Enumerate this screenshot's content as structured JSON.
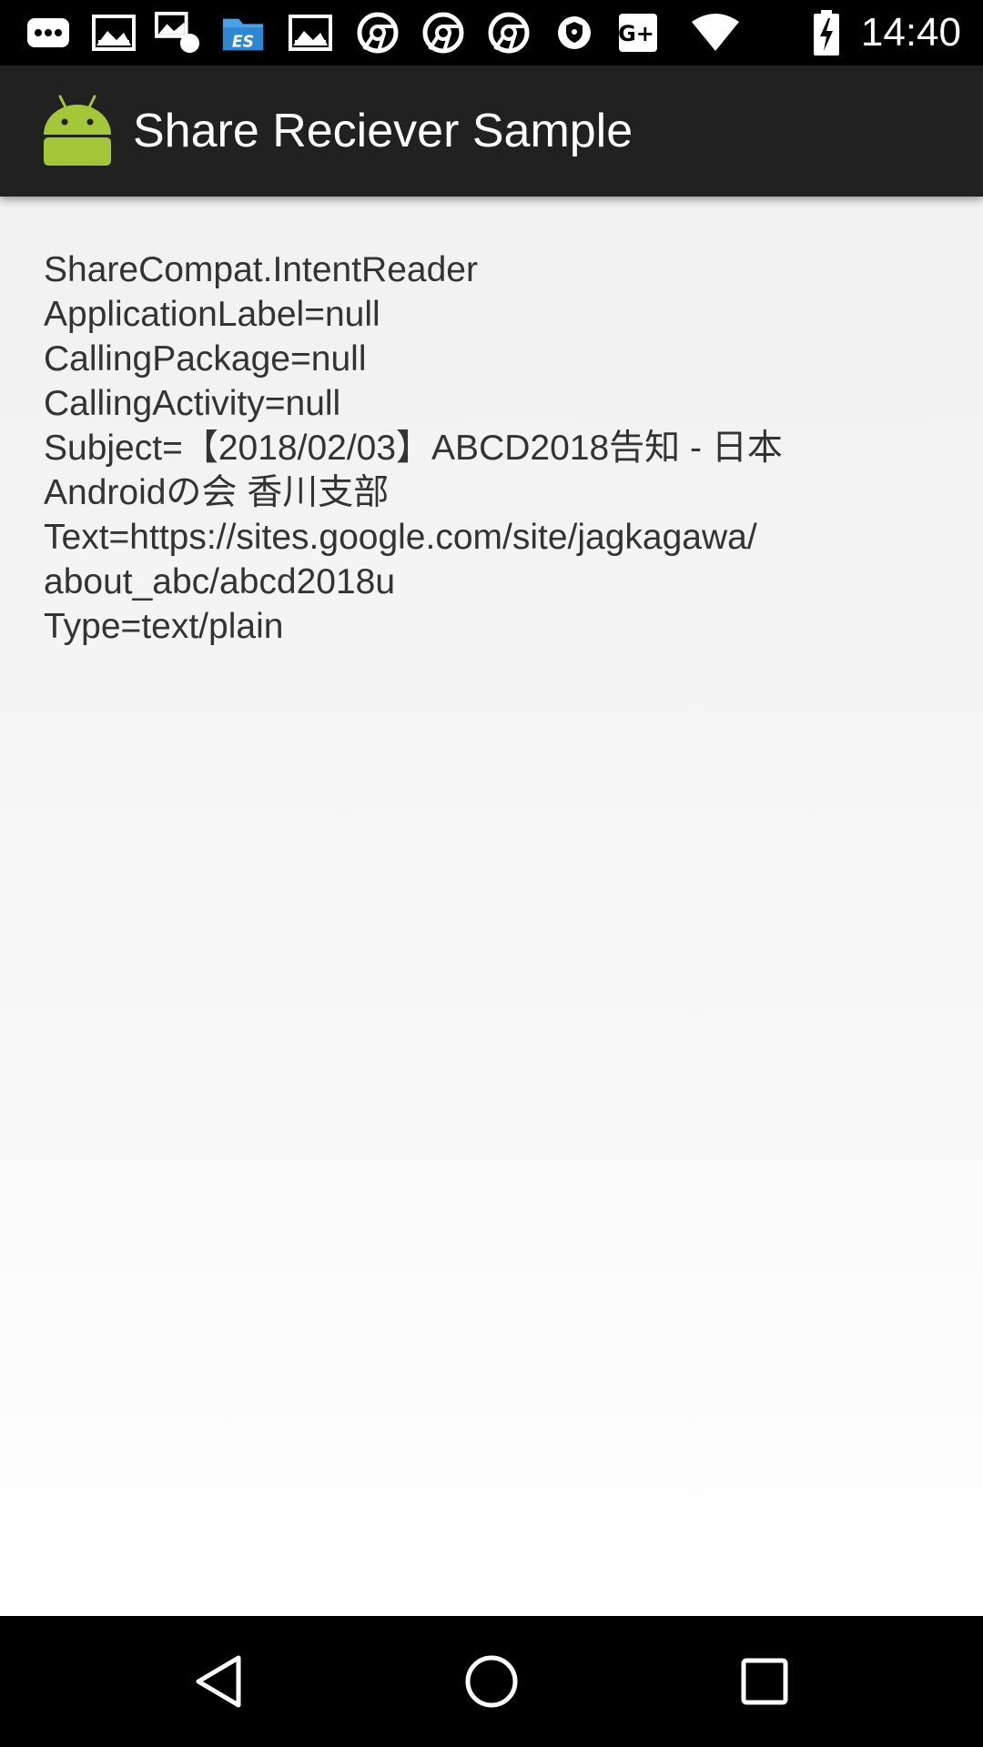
{
  "status_bar": {
    "time": "14:40",
    "notification_icons": [
      "more-notifications-icon",
      "image-icon",
      "image-icon",
      "file-manager-icon",
      "image-icon",
      "chrome-icon",
      "chrome-icon",
      "chrome-icon",
      "shield-icon",
      "google-plus-icon"
    ],
    "system_icons": [
      "wifi-icon",
      "battery-charging-icon"
    ]
  },
  "app_bar": {
    "title": "Share Reciever Sample",
    "icon": "android-icon",
    "color": "#212121"
  },
  "content": {
    "lines": [
      "ShareCompat.IntentReader",
      "ApplicationLabel=null",
      "CallingPackage=null",
      "CallingActivity=null",
      "Subject=【2018/02/03】ABCD2018告知 - 日本",
      "Androidの会 香川支部",
      "Text=https://sites.google.com/site/jagkagawa/",
      "about_abc/abcd2018u",
      "Type=text/plain"
    ]
  },
  "nav_bar": {
    "buttons": [
      "back-icon",
      "home-icon",
      "recents-icon"
    ]
  }
}
